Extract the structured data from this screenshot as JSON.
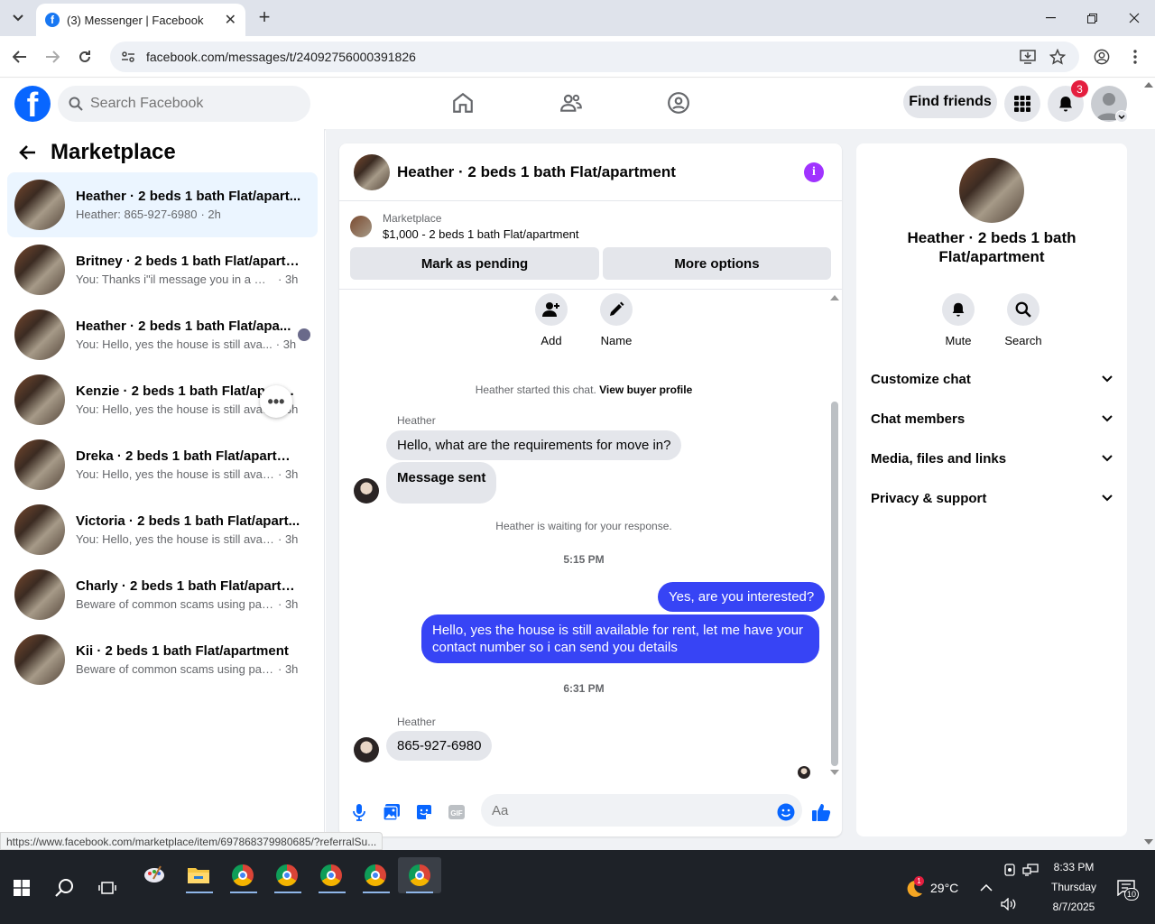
{
  "browser": {
    "tab_title": "(3) Messenger | Facebook",
    "url": "facebook.com/messages/t/24092756000391826",
    "status_url": "https://www.facebook.com/marketplace/item/697868379980685/?referralSu..."
  },
  "fb": {
    "search_placeholder": "Search Facebook",
    "find_friends": "Find friends",
    "notification_count": "3"
  },
  "left": {
    "title": "Marketplace",
    "conversations": [
      {
        "name": "Heather · 2 beds 1 bath Flat/apart...",
        "preview": "Heather: 865-927-6980",
        "time": "· 2h"
      },
      {
        "name": "Britney · 2 beds 1 bath Flat/apartm...",
        "preview": "You: Thanks i\"il message you in a mo...",
        "time": "· 3h"
      },
      {
        "name": "Heather · 2 beds 1 bath Flat/apa...",
        "preview": "You: Hello, yes the house is still ava...",
        "time": "· 3h"
      },
      {
        "name": "Kenzie · 2 beds 1 bath Flat/apart...",
        "preview": "You: Hello, yes the house is still avail...",
        "time": "· 3h"
      },
      {
        "name": "Dreka · 2 beds 1 bath Flat/apartme...",
        "preview": "You: Hello, yes the house is still availa...",
        "time": "· 3h"
      },
      {
        "name": "Victoria · 2 beds 1 bath Flat/apart...",
        "preview": "You: Hello, yes the house is still availa...",
        "time": "· 3h"
      },
      {
        "name": "Charly · 2 beds 1 bath Flat/apartm...",
        "preview": "Beware of common scams using pay...",
        "time": "· 3h"
      },
      {
        "name": "Kii · 2 beds 1 bath Flat/apartment",
        "preview": "Beware of common scams using pay...",
        "time": "· 3h"
      }
    ]
  },
  "chat": {
    "title": "Heather · 2 beds 1 bath Flat/apartment",
    "listing_label": "Marketplace",
    "listing_price": "$1,000 - 2 beds 1 bath Flat/apartment",
    "mark_pending": "Mark as pending",
    "more_options": "More options",
    "add_label": "Add",
    "name_label": "Name",
    "started_text": "Heather started this chat.",
    "buyer_profile_link": "View buyer profile",
    "sender1": "Heather",
    "msg1": "Hello, what are the requirements for move in?",
    "msg2": "Message sent",
    "waiting": "Heather is waiting for your response.",
    "time1": "5:15 PM",
    "out1": "Yes, are you interested?",
    "out2": "Hello, yes the house is still available for rent, let me have your contact number so i can send you details",
    "time2": "6:31 PM",
    "sender2": "Heather",
    "msg3": "865-927-6980",
    "composer_placeholder": "Aa"
  },
  "right": {
    "name": "Heather · 2 beds 1 bath Flat/apartment",
    "mute": "Mute",
    "search": "Search",
    "sections": [
      "Customize chat",
      "Chat members",
      "Media, files and links",
      "Privacy & support"
    ]
  },
  "taskbar": {
    "temperature": "29°C",
    "weather_badge": "1",
    "time": "8:33 PM",
    "day": "Thursday",
    "date": "8/7/2025",
    "notif_count": "10"
  },
  "colors": {
    "fb_blue": "#0866ff",
    "outgoing_bubble": "#3744f5",
    "info_purple": "#a033ff",
    "badge_red": "#e41e3f"
  }
}
